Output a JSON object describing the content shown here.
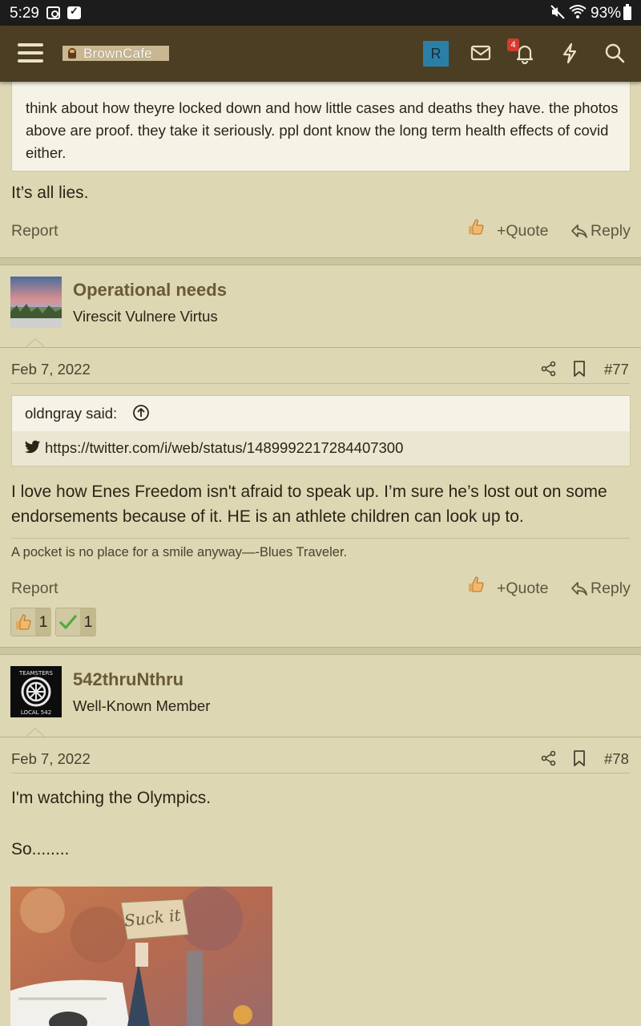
{
  "status_bar": {
    "time": "5:29",
    "battery": "93%"
  },
  "navbar": {
    "logo_text": "BrownCafe",
    "avatar_letter": "R",
    "notification_count": "4",
    "colors": {
      "navbar_bg": "#4b3e22",
      "avatar_bg": "#2a7fa6",
      "badge_bg": "#d33b2f"
    }
  },
  "post76": {
    "quote_text": "think about how theyre locked down and how little cases and deaths they have. the photos above are proof. they take it seriously. ppl dont know the long term health effects of covid either.",
    "body": "It’s all lies.",
    "report": "Report",
    "quote": "Quote",
    "reply": "Reply"
  },
  "post77": {
    "username": "Operational needs",
    "user_title": "Virescit Vulnere Virtus",
    "date": "Feb 7, 2022",
    "number": "#77",
    "quote_author": "oldngray said:",
    "quote_link": "https://twitter.com/i/web/status/1489992217284407300",
    "body": "I love how Enes Freedom isn't afraid to speak up. I’m sure he’s lost out on some endorsements because of it. HE is an athlete children can look up to.",
    "signature": "A pocket is no place for a smile anyway—-Blues Traveler.",
    "report": "Report",
    "quote": "Quote",
    "reply": "Reply",
    "reactions": [
      {
        "icon": "thumbs-up-icon",
        "count": "1"
      },
      {
        "icon": "check-icon",
        "count": "1"
      }
    ]
  },
  "post78": {
    "username": "542thruNthru",
    "user_title": "Well-Known Member",
    "date": "Feb 7, 2022",
    "number": "#78",
    "body_line1": "I'm watching the Olympics.",
    "body_line2": "So........",
    "image_sign_text": "Suck it",
    "avatar_ring_text_top": "TEAMSTERS",
    "avatar_ring_text_bottom": "LOCAL 542"
  }
}
